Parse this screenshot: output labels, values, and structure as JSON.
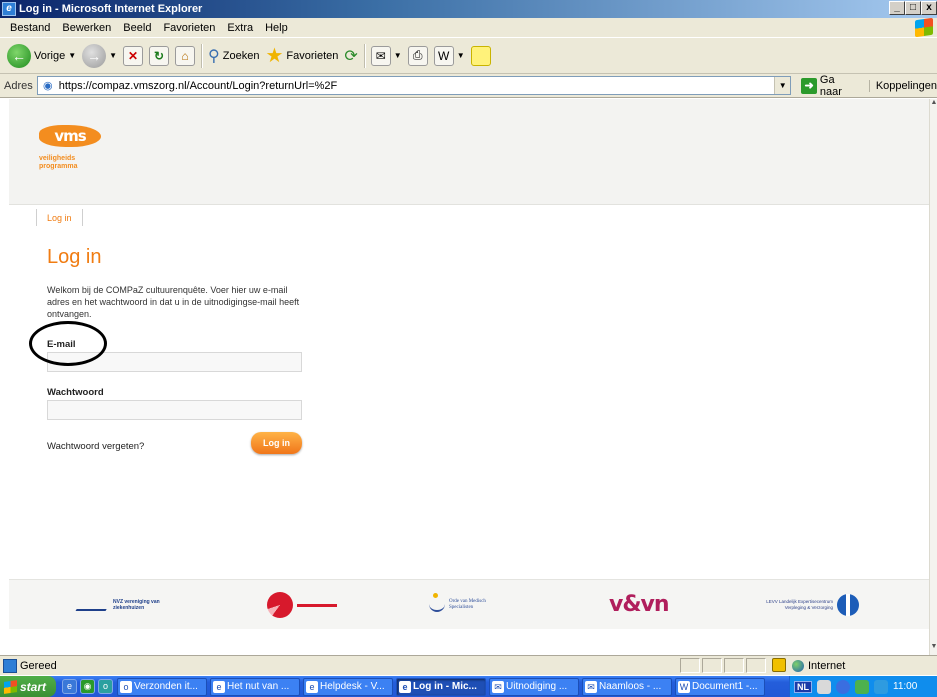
{
  "window": {
    "title": "Log in - Microsoft Internet Explorer",
    "controls": [
      "_",
      "□",
      "x"
    ]
  },
  "menu": [
    "Bestand",
    "Bewerken",
    "Beeld",
    "Favorieten",
    "Extra",
    "Help"
  ],
  "toolbar": {
    "back_label": "Vorige",
    "search_label": "Zoeken",
    "favorites_label": "Favorieten"
  },
  "addressbar": {
    "label": "Adres",
    "url": "https://compaz.vmszorg.nl/Account/Login?returnUrl=%2F",
    "go_label": "Ga naar",
    "links_label": "Koppelingen"
  },
  "site": {
    "logo_text": "vms",
    "logo_sub_1": "veiligheids",
    "logo_sub_2": "programma",
    "nav_login": "Log in",
    "page_title": "Log in",
    "intro": "Welkom bij de COMPaZ cultuurenquête. Voer hier uw e-mail adres en het wachtwoord in dat u in de uitnodigingse-mail heeft ontvangen.",
    "email_label": "E-mail",
    "email_value": "",
    "password_label": "Wachtwoord",
    "password_value": "",
    "forgot_label": "Wachtwoord vergeten?",
    "login_button": "Log in"
  },
  "footer": {
    "nvz_text": "NVZ vereniging van ziekenhuizen",
    "ords_text": "Orde van Medisch Specialisten",
    "vvn_text": "v&vn",
    "levv_text": "LEVV Landelijk Expertisecentrum Verpleging & Verzorging"
  },
  "statusbar": {
    "status": "Gereed",
    "zone": "Internet"
  },
  "taskbar": {
    "start_label": "start",
    "tasks": [
      "Verzonden it...",
      "Het nut van ...",
      "Helpdesk - V...",
      "Log in - Mic...",
      "Uitnodiging ...",
      "Naamloos - ...",
      "Document1 -..."
    ],
    "language": "NL",
    "clock": "11:00"
  }
}
